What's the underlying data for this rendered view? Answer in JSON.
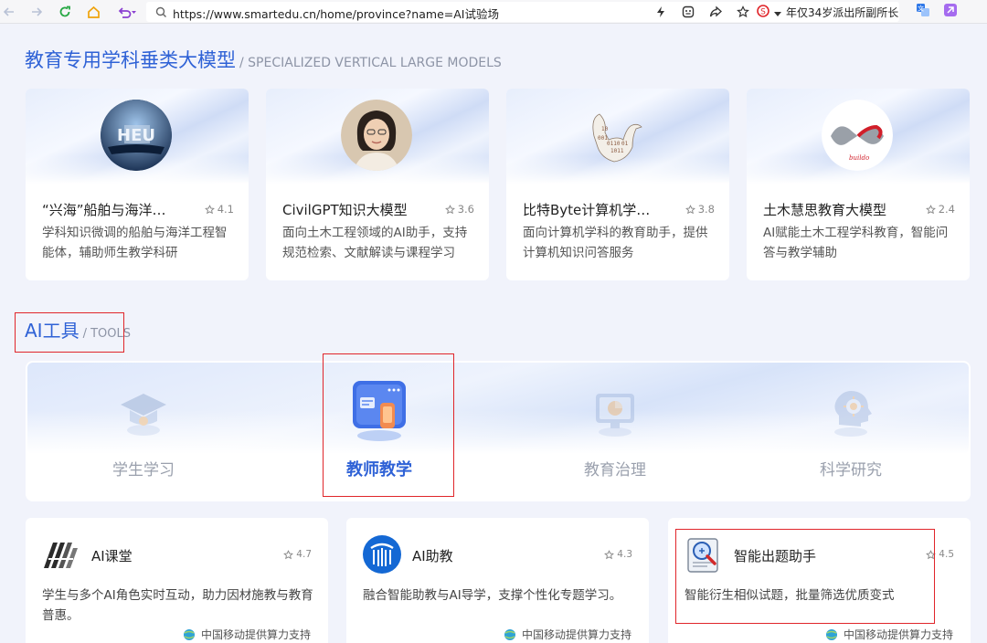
{
  "browser": {
    "url": "https://www.smartedu.cn/home/province?name=AI试验场",
    "news_ticker": "年仅34岁派出所副所长",
    "icons": [
      "back-icon",
      "forward-icon",
      "reload-icon",
      "home-icon",
      "undo-icon",
      "search-icon",
      "lightning-icon",
      "screenshot-icon",
      "share-icon",
      "star-icon",
      "sogou-icon",
      "translate-icon",
      "extension-icon"
    ]
  },
  "models_section": {
    "title": "教育专用学科垂类大模型",
    "subtitle": "/ SPECIALIZED VERTICAL LARGE MODELS",
    "cards": [
      {
        "title": "“兴海”船舶与海洋…",
        "rating": "4.1",
        "desc": "学科知识微调的船舶与海洋工程智能体，辅助师生教学科研",
        "logo": "heu-ship-logo"
      },
      {
        "title": "CivilGPT知识大模型",
        "rating": "3.6",
        "desc": "面向土木工程领域的AI助手，支持规范检索、文献解读与课程学习",
        "logo": "woman-avatar-logo"
      },
      {
        "title": "比特Byte计算机学…",
        "rating": "3.8",
        "desc": "面向计算机学科的教育助手，提供计算机知识问答服务",
        "logo": "binary-swan-logo"
      },
      {
        "title": "土木慧思教育大模型",
        "rating": "2.4",
        "desc": "AI赋能土木工程学科教育，智能问答与教学辅助",
        "logo": "infinity-ribbon-logo"
      }
    ]
  },
  "tools_section": {
    "title": "AI工具",
    "subtitle": "/ TOOLS",
    "categories": [
      {
        "label": "学生学习",
        "icon": "graduation-cap-icon",
        "active": false
      },
      {
        "label": "教师教学",
        "icon": "teacher-screen-icon",
        "active": true
      },
      {
        "label": "教育治理",
        "icon": "monitor-chart-icon",
        "active": false
      },
      {
        "label": "科学研究",
        "icon": "research-head-icon",
        "active": false
      }
    ],
    "cards": [
      {
        "name": "AI课堂",
        "rating": "4.7",
        "desc": "学生与多个AI角色实时互动，助力因材施教与教育普惠。",
        "sponsor": "中国移动提供算力支持",
        "logo": "ai-classroom-logo"
      },
      {
        "name": "AI助教",
        "rating": "4.3",
        "desc": "融合智能助教与AI导学，支撑个性化专题学习。",
        "sponsor": "中国移动提供算力支持",
        "logo": "ai-assistant-logo"
      },
      {
        "name": "智能出题助手",
        "rating": "4.5",
        "desc": "智能衍生相似试题，批量筛选优质变式",
        "sponsor": "中国移动提供算力支持",
        "logo": "question-generator-logo"
      }
    ]
  },
  "colors": {
    "accent": "#2f62d6",
    "highlight": "#e0252a",
    "muted": "#9aa0ad",
    "page_bg": "#f1f3fb"
  }
}
